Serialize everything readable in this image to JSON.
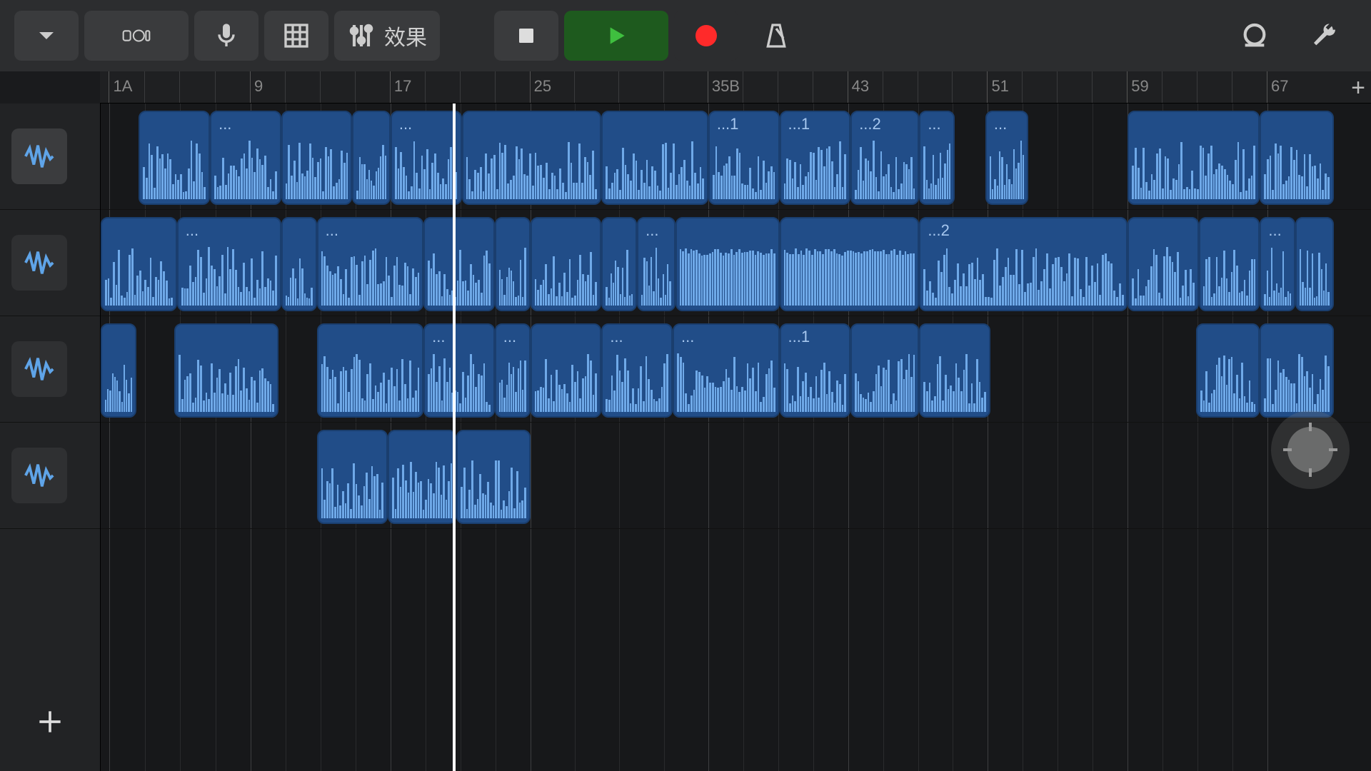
{
  "toolbar": {
    "fx_label": "效果"
  },
  "ruler": {
    "markers": [
      {
        "pos": 0.007,
        "label": "1A"
      },
      {
        "pos": 0.118,
        "label": "9"
      },
      {
        "pos": 0.228,
        "label": "17"
      },
      {
        "pos": 0.338,
        "label": "25"
      },
      {
        "pos": 0.478,
        "label": "35B"
      },
      {
        "pos": 0.588,
        "label": "43"
      },
      {
        "pos": 0.698,
        "label": "51"
      },
      {
        "pos": 0.808,
        "label": "59"
      },
      {
        "pos": 0.918,
        "label": "67"
      }
    ],
    "minor_ticks_per_major": 4,
    "add_label": "+"
  },
  "playhead_fraction": 0.277,
  "colors": {
    "clip_bg": "#214d88",
    "clip_border": "#1a3e6e",
    "wave": "#6fa9e8",
    "play_btn": "#1e5a1e",
    "record": "#ff2a2a"
  },
  "tracks": [
    {
      "selected": true,
      "clips": [
        {
          "start": 0.03,
          "end": 0.086,
          "label": "",
          "seed": 1
        },
        {
          "start": 0.086,
          "end": 0.142,
          "label": "...",
          "seed": 2
        },
        {
          "start": 0.142,
          "end": 0.198,
          "label": "",
          "seed": 3
        },
        {
          "start": 0.198,
          "end": 0.228,
          "label": "",
          "seed": 4
        },
        {
          "start": 0.228,
          "end": 0.284,
          "label": "...",
          "seed": 5
        },
        {
          "start": 0.284,
          "end": 0.394,
          "label": "",
          "seed": 6
        },
        {
          "start": 0.394,
          "end": 0.478,
          "label": "",
          "seed": 7
        },
        {
          "start": 0.478,
          "end": 0.534,
          "label": "...1",
          "seed": 8
        },
        {
          "start": 0.534,
          "end": 0.59,
          "label": "...1",
          "seed": 9
        },
        {
          "start": 0.59,
          "end": 0.644,
          "label": "...2",
          "seed": 10
        },
        {
          "start": 0.644,
          "end": 0.672,
          "label": "...",
          "seed": 11
        },
        {
          "start": 0.696,
          "end": 0.73,
          "label": "...",
          "seed": 12
        },
        {
          "start": 0.808,
          "end": 0.912,
          "label": "",
          "seed": 13
        },
        {
          "start": 0.912,
          "end": 0.97,
          "label": "",
          "seed": 14
        }
      ]
    },
    {
      "selected": false,
      "clips": [
        {
          "start": 0.0,
          "end": 0.06,
          "label": "",
          "seed": 20
        },
        {
          "start": 0.06,
          "end": 0.142,
          "label": "...",
          "seed": 21
        },
        {
          "start": 0.142,
          "end": 0.17,
          "label": "",
          "seed": 22
        },
        {
          "start": 0.17,
          "end": 0.254,
          "label": "...",
          "seed": 23
        },
        {
          "start": 0.254,
          "end": 0.31,
          "label": "",
          "seed": 24
        },
        {
          "start": 0.31,
          "end": 0.338,
          "label": "",
          "seed": 25
        },
        {
          "start": 0.338,
          "end": 0.394,
          "label": "",
          "seed": 26
        },
        {
          "start": 0.394,
          "end": 0.422,
          "label": "",
          "seed": 27
        },
        {
          "start": 0.422,
          "end": 0.452,
          "label": "...",
          "seed": 28
        },
        {
          "start": 0.452,
          "end": 0.534,
          "label": "",
          "seed": 29,
          "flat": true
        },
        {
          "start": 0.534,
          "end": 0.644,
          "label": "",
          "seed": 30,
          "flat": true
        },
        {
          "start": 0.644,
          "end": 0.808,
          "label": "...2",
          "seed": 31
        },
        {
          "start": 0.808,
          "end": 0.864,
          "label": "",
          "seed": 32
        },
        {
          "start": 0.864,
          "end": 0.912,
          "label": "",
          "seed": 33
        },
        {
          "start": 0.912,
          "end": 0.94,
          "label": "...",
          "seed": 34
        },
        {
          "start": 0.94,
          "end": 0.97,
          "label": "",
          "seed": 35
        }
      ]
    },
    {
      "selected": false,
      "clips": [
        {
          "start": 0.0,
          "end": 0.028,
          "label": "",
          "seed": 40
        },
        {
          "start": 0.058,
          "end": 0.14,
          "label": "",
          "seed": 41
        },
        {
          "start": 0.17,
          "end": 0.254,
          "label": "",
          "seed": 42
        },
        {
          "start": 0.254,
          "end": 0.31,
          "label": "...",
          "seed": 43
        },
        {
          "start": 0.31,
          "end": 0.338,
          "label": "...",
          "seed": 44
        },
        {
          "start": 0.338,
          "end": 0.394,
          "label": "",
          "seed": 45
        },
        {
          "start": 0.394,
          "end": 0.45,
          "label": "...",
          "seed": 46
        },
        {
          "start": 0.45,
          "end": 0.534,
          "label": "...",
          "seed": 47
        },
        {
          "start": 0.534,
          "end": 0.59,
          "label": "...1",
          "seed": 48
        },
        {
          "start": 0.59,
          "end": 0.644,
          "label": "",
          "seed": 49
        },
        {
          "start": 0.644,
          "end": 0.7,
          "label": "",
          "seed": 50
        },
        {
          "start": 0.862,
          "end": 0.912,
          "label": "",
          "seed": 51
        },
        {
          "start": 0.912,
          "end": 0.97,
          "label": "",
          "seed": 52
        }
      ]
    },
    {
      "selected": false,
      "clips": [
        {
          "start": 0.17,
          "end": 0.226,
          "label": "",
          "seed": 60
        },
        {
          "start": 0.226,
          "end": 0.28,
          "label": "",
          "seed": 61
        },
        {
          "start": 0.28,
          "end": 0.338,
          "label": "",
          "seed": 62
        }
      ]
    }
  ]
}
